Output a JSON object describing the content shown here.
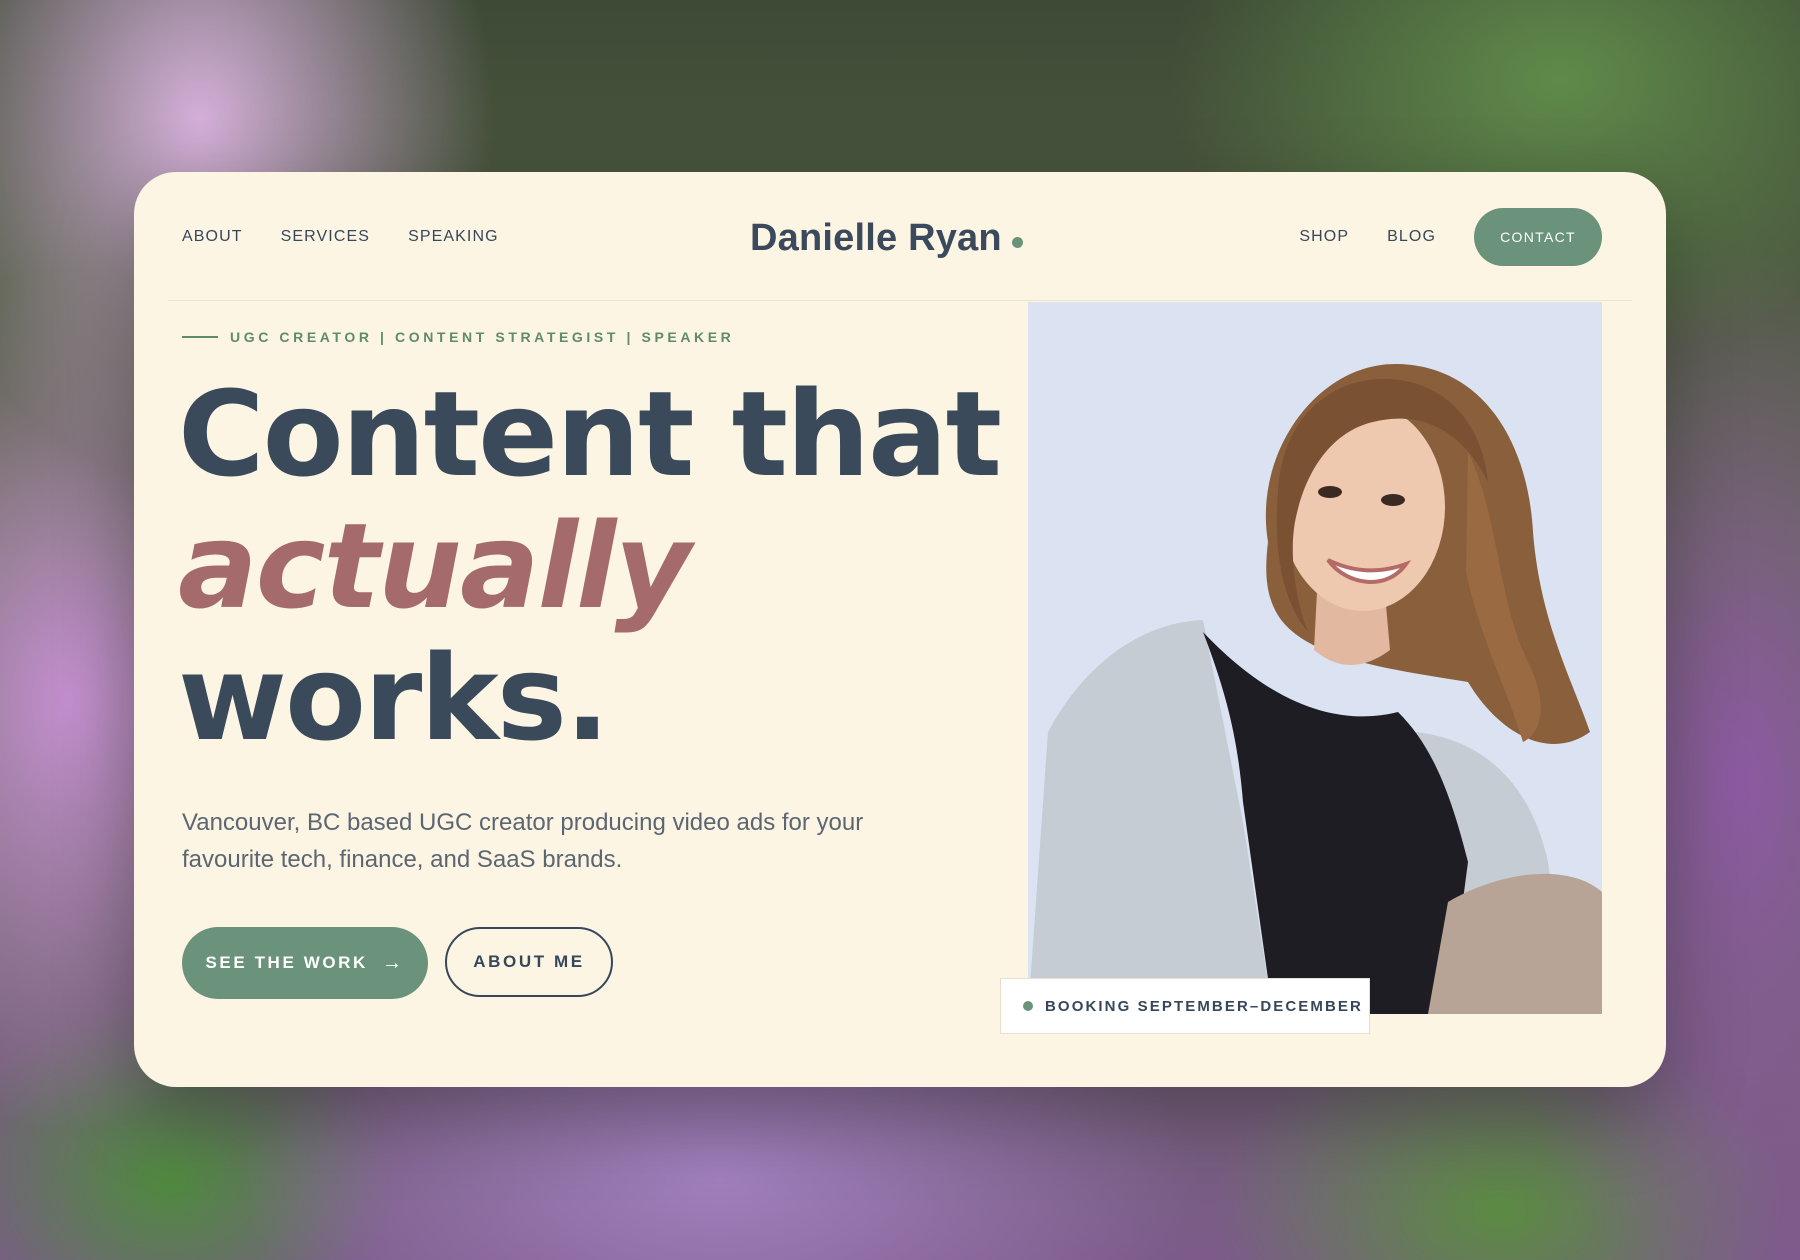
{
  "nav": {
    "left_links": [
      "ABOUT",
      "SERVICES",
      "SPEAKING"
    ],
    "brand": "Danielle Ryan",
    "right_links": [
      "SHOP",
      "BLOG"
    ],
    "contact_label": "CONTACT"
  },
  "hero": {
    "eyebrow": "UGC CREATOR | CONTENT STRATEGIST | SPEAKER",
    "headline_line1": "Content that",
    "headline_accent": "actually",
    "headline_line3": "works.",
    "description": "Vancouver, BC based UGC creator producing video ads for your favourite tech, finance, and SaaS brands.",
    "primary_button": "SEE THE WORK",
    "primary_button_icon": "→",
    "secondary_button": "ABOUT ME"
  },
  "booking": {
    "label": "BOOKING SEPTEMBER–DECEMBER"
  },
  "colors": {
    "card_background": "#fcf5e3",
    "navy_text": "#3a4a5a",
    "accent_rose": "#a46a6c",
    "accent_green": "#6b927a",
    "photo_background": "#dbe3f2"
  }
}
